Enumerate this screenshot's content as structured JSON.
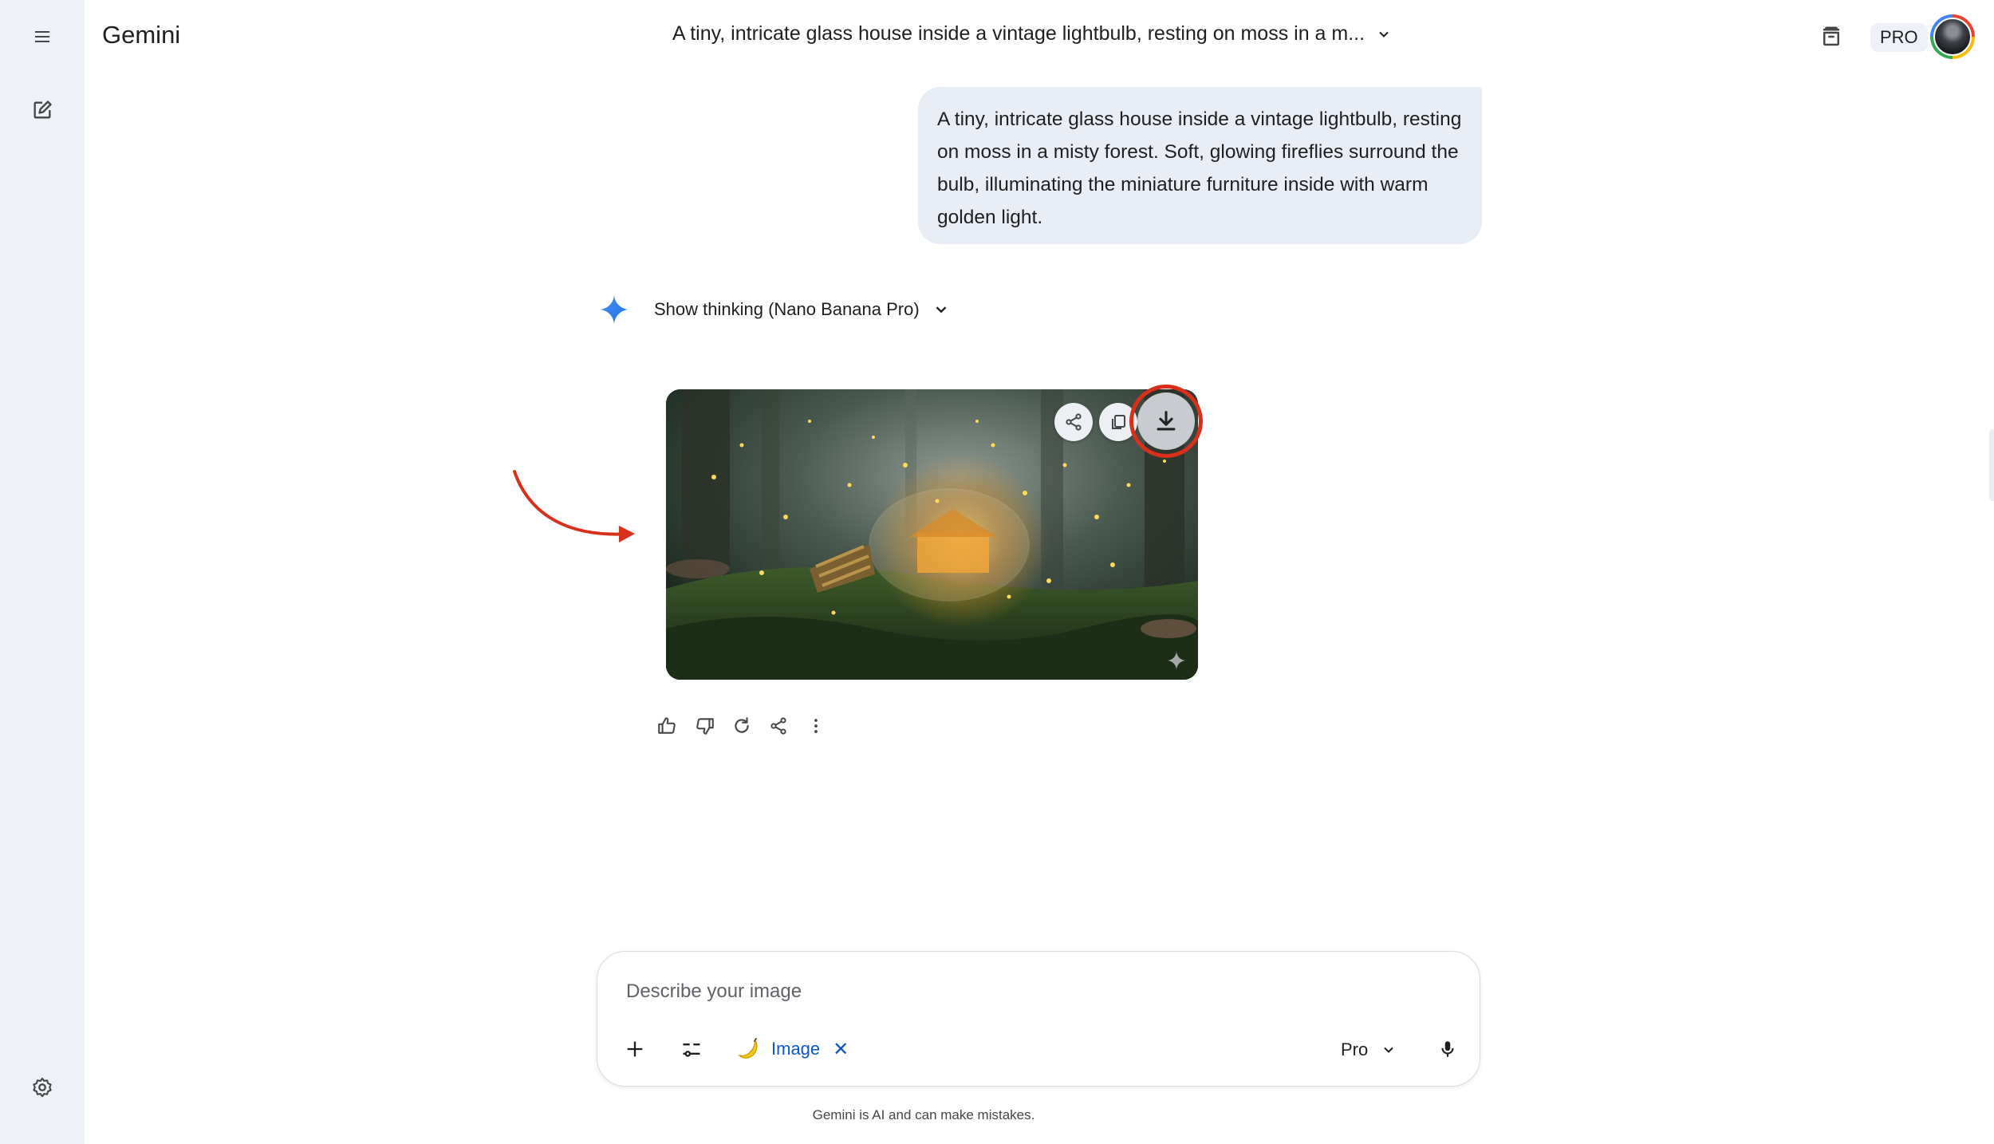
{
  "app": {
    "title": "Gemini"
  },
  "conversation": {
    "title": "A tiny, intricate glass house inside a vintage lightbulb, resting on moss in a m..."
  },
  "header": {
    "plan_badge": "PRO"
  },
  "user_message": {
    "text": "A tiny, intricate glass house inside a vintage lightbulb, resting on moss in a misty forest. Soft, glowing fireflies surround the bulb, illuminating the miniature furniture inside with warm golden light."
  },
  "response": {
    "thinking_label": "Show thinking (Nano Banana Pro)"
  },
  "composer": {
    "placeholder": "Describe your image",
    "tool_chip_label": "Image",
    "tool_chip_close": "✕",
    "model_label": "Pro"
  },
  "footer": {
    "disclaimer": "Gemini is AI and can make mistakes."
  },
  "colors": {
    "accent_blue": "#0b57d0",
    "sidebar_bg": "#eef1f8",
    "bubble_bg": "#e9eef6",
    "annotation_red": "#d9301c"
  }
}
